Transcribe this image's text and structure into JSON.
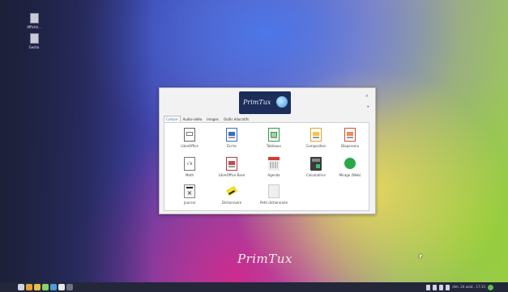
{
  "desktop": {
    "icons": [
      {
        "label": "Affiché..."
      },
      {
        "label": "Gestio"
      }
    ]
  },
  "window": {
    "logo_text": "PrimTux",
    "close_glyph": "×",
    "more_glyph": "▸",
    "tabs": [
      {
        "label": "Culture",
        "active": true
      },
      {
        "label": "Audio-vidéo",
        "active": false
      },
      {
        "label": "Images",
        "active": false
      },
      {
        "label": "Outils éducatifs",
        "active": false
      }
    ],
    "apps": [
      {
        "label": "LibreOffice",
        "icon": "libreoffice-icon"
      },
      {
        "label": "Écrire",
        "icon": "writer-icon"
      },
      {
        "label": "Tableaux",
        "icon": "calc-icon"
      },
      {
        "label": "Composition",
        "icon": "draw-icon"
      },
      {
        "label": "Diaporama",
        "icon": "impress-icon"
      },
      {
        "label": "Math",
        "icon": "math-icon"
      },
      {
        "label": "LibreOffice Base",
        "icon": "base-icon"
      },
      {
        "label": "Agenda",
        "icon": "agenda-icon"
      },
      {
        "label": "Calculatrice",
        "icon": "calculator-icon"
      },
      {
        "label": "Mirage (Web)",
        "icon": "browser-icon"
      },
      {
        "label": "Journal",
        "icon": "journal-icon"
      },
      {
        "label": "Dictionnaire",
        "icon": "dictionary-icon"
      },
      {
        "label": "Petit dictionnaire",
        "icon": "small-dictionary-icon"
      }
    ],
    "math_symbol": "√x",
    "journal_symbol": "×"
  },
  "brand_text": "PrimTux",
  "taskbar": {
    "clock": "dim. 24 août , 17:15",
    "launcher_colors": [
      "#cfd4e2",
      "#e7a03a",
      "#e6c14a",
      "#8ad06a",
      "#4b9be0",
      "#e8e8e8",
      "#6b7186"
    ]
  }
}
